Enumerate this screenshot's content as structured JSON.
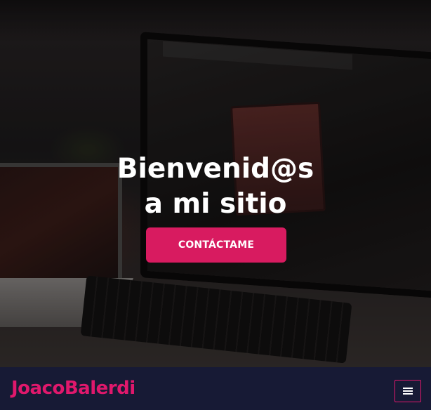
{
  "hero": {
    "title_line1": "Bienvenid@s",
    "title_line2": "a mi sitio",
    "cta_label": "CONTÁCTAME"
  },
  "navbar": {
    "brand": "JoacoBalerdi",
    "menu_icon": "hamburger-menu-icon"
  },
  "colors": {
    "accent": "#d81b60",
    "brand_text": "#e0186c",
    "navbar_bg": "#171a35",
    "hero_text": "#ffffff"
  }
}
